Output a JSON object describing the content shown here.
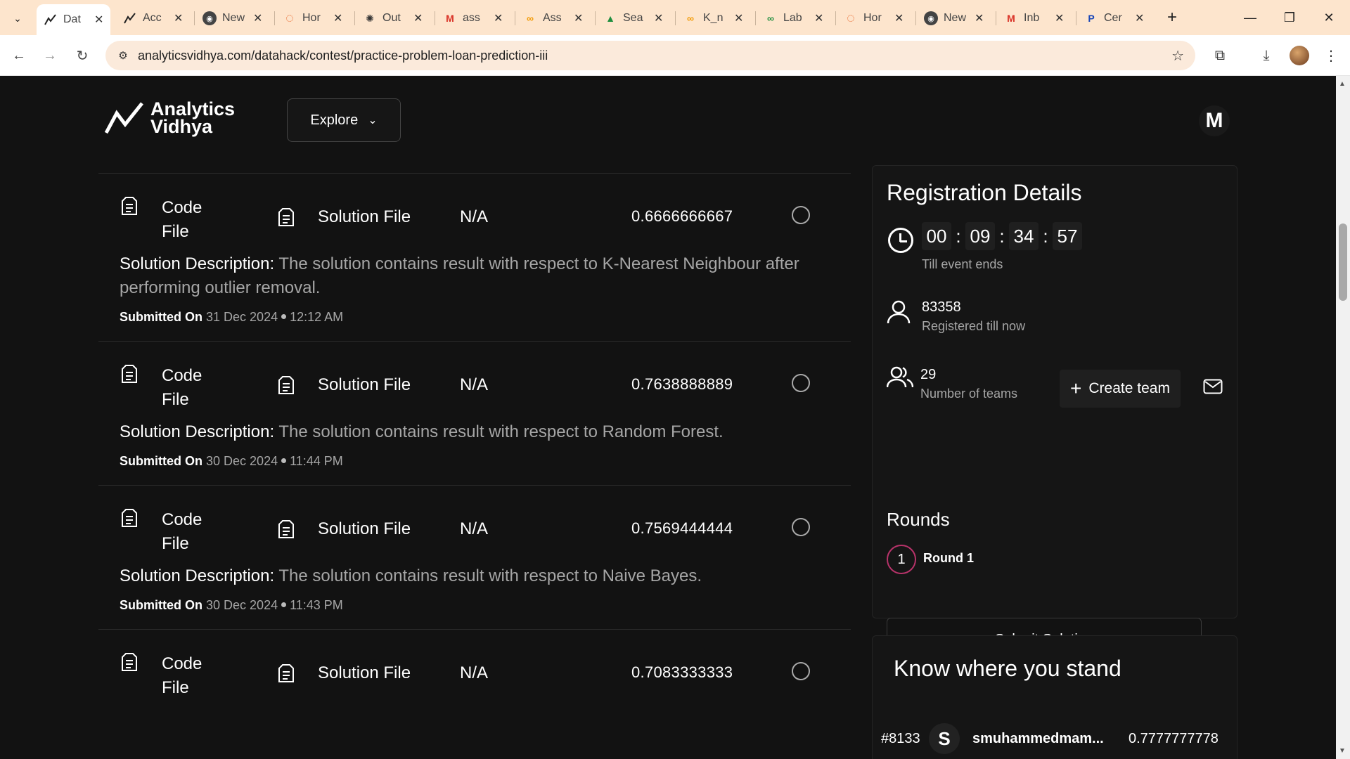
{
  "browser": {
    "tabs": [
      {
        "label": "Dat",
        "icon": "analytics-vidhya-favicon",
        "active": true
      },
      {
        "label": "Acc",
        "icon": "analytics-vidhya-favicon",
        "active": false
      },
      {
        "label": "New",
        "icon": "chrome-favicon",
        "active": false
      },
      {
        "label": "Hor",
        "icon": "loading-favicon",
        "active": false
      },
      {
        "label": "Out",
        "icon": "openai-favicon",
        "active": false
      },
      {
        "label": "ass",
        "icon": "gmail-favicon",
        "active": false
      },
      {
        "label": "Ass",
        "icon": "colab-favicon",
        "active": false
      },
      {
        "label": "Sea",
        "icon": "drive-favicon",
        "active": false
      },
      {
        "label": "K_n",
        "icon": "colab-favicon",
        "active": false
      },
      {
        "label": "Lab",
        "icon": "lab-favicon",
        "active": false
      },
      {
        "label": "Hor",
        "icon": "loading-favicon",
        "active": false
      },
      {
        "label": "New",
        "icon": "chrome-favicon",
        "active": false
      },
      {
        "label": "Inb",
        "icon": "gmail-favicon",
        "active": false
      },
      {
        "label": "Cer",
        "icon": "p-favicon",
        "active": false
      }
    ],
    "url": "analyticsvidhya.com/datahack/contest/practice-problem-loan-prediction-iii"
  },
  "header": {
    "logo_line1": "Analytics",
    "logo_line2": "Vidhya",
    "explore_label": "Explore",
    "avatar_initial": "M"
  },
  "submissions": [
    {
      "code_label": "Code File",
      "solution_label": "Solution File",
      "na": "N/A",
      "score": "0.6666666667",
      "desc_label": "Solution Description:",
      "desc": "The solution contains result with respect to K-Nearest Neighbour after performing outlier removal.",
      "submitted_label": "Submitted On",
      "date": "31 Dec 2024",
      "time": "12:12 AM"
    },
    {
      "code_label": "Code File",
      "solution_label": "Solution File",
      "na": "N/A",
      "score": "0.7638888889",
      "desc_label": "Solution Description:",
      "desc": "The solution contains result with respect to Random Forest.",
      "submitted_label": "Submitted On",
      "date": "30 Dec 2024",
      "time": "11:44 PM"
    },
    {
      "code_label": "Code File",
      "solution_label": "Solution File",
      "na": "N/A",
      "score": "0.7569444444",
      "desc_label": "Solution Description:",
      "desc": "The solution contains result with respect to Naive Bayes.",
      "submitted_label": "Submitted On",
      "date": "30 Dec 2024",
      "time": "11:43 PM"
    },
    {
      "code_label": "Code File",
      "solution_label": "Solution File",
      "na": "N/A",
      "score": "0.7083333333"
    }
  ],
  "registration": {
    "title": "Registration Details",
    "timer": {
      "h": "00",
      "m": "09",
      "s": "34",
      "f": "57"
    },
    "timer_caption": "Till event ends",
    "registered_count": "83358",
    "registered_caption": "Registered till now",
    "teams_count": "29",
    "teams_caption": "Number of teams",
    "create_team_label": "Create team",
    "rounds_title": "Rounds",
    "round_number": "1",
    "round_label": "Round 1",
    "submit_label": "Submit Solution"
  },
  "leaderboard": {
    "title": "Know where you stand",
    "rank": "#8133",
    "avatar_initial": "S",
    "name": "smuhammedmam...",
    "score": "0.7777777778"
  }
}
